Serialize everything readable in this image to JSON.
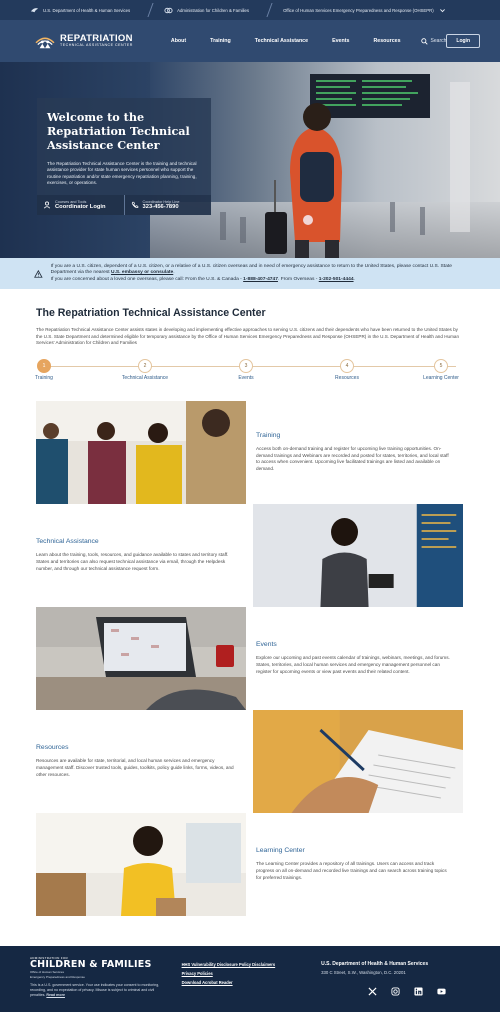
{
  "gov_bar": {
    "items": [
      {
        "label": "U.S. Department of Health & Human Services"
      },
      {
        "label": "Administration for Children & Families"
      },
      {
        "label": "Office of Human Services Emergency Preparedness and Response (OHSEPR)"
      }
    ]
  },
  "header": {
    "logo_title": "REPATRIATION",
    "logo_subtitle": "TECHNICAL ASSISTANCE CENTER",
    "nav": [
      {
        "label": "About"
      },
      {
        "label": "Training"
      },
      {
        "label": "Technical Assistance"
      },
      {
        "label": "Events"
      },
      {
        "label": "Resources"
      }
    ],
    "search_label": "Search",
    "login_label": "Login"
  },
  "hero": {
    "title": "Welcome to the Repatriation Technical Assistance Center",
    "description": "The Repatriation Technical Assistance Center is the training and technical assistance provider for state human services personnel who support the routine repatriation and/or state emergency repatriation planning, training, exercises, or operations.",
    "links": [
      {
        "label": "Courses and Tools",
        "value": "Coordinator Login"
      },
      {
        "label": "Coordinator Help Line",
        "value": "323-456-7890"
      }
    ]
  },
  "alert": {
    "line1": "If you are a U.S. citizen, dependent of a U.S. citizen, or a relative of a U.S. citizen overseas and in need of emergency assistance to return to the United States, please contact U.S. State Department via the nearest",
    "link1": "U.S. embassy or consulate",
    "line2": "If you are concerned about a loved one overseas, please call: From the U.S. & Canada -",
    "phone1": "1-888-407-4747",
    "line3": "From Overseas -",
    "phone2": "1-202-501-4444"
  },
  "intro": {
    "title": "The Repatriation Technical Assistance Center",
    "body": "The Repatriation Technical Assistance Center assists states in developing and implementing effective approaches to serving U.S. citizens and their dependents who have been returned to the United States by the U.S. State Department and determined eligible for temporary assistance by the Office of Human Services Emergency Preparedness and Response (OHSEPR) in the U.S. Department of Health and Human Services' Administration for Children and Families"
  },
  "steps": [
    {
      "num": "1",
      "label": "Training"
    },
    {
      "num": "2",
      "label": "Technical Assistance"
    },
    {
      "num": "3",
      "label": "Events"
    },
    {
      "num": "4",
      "label": "Resources"
    },
    {
      "num": "5",
      "label": "Learning Center"
    }
  ],
  "features": [
    {
      "title": "Training",
      "body": "Access both on-demand training and register for upcoming live training opportunities. On-demand trainings and Webinars are recorded and posted for states, territories, and local staff to access when convenient. Upcoming live facilitated trainings are listed and available on demand."
    },
    {
      "title": "Technical Assistance",
      "body": "Learn about the training, tools, resources, and guidance available to states and territory staff. States and territories can also request technical assistance via email, through the Helpdesk number, and through our technical assistance request form."
    },
    {
      "title": "Events",
      "body": "Explore our upcoming and past events calendar of trainings, webinars, meetings, and forums. States, territories, and local human services and emergency management personnel can register for upcoming events or view past events and their related content."
    },
    {
      "title": "Resources",
      "body": "Resources are available for state, territorial, and local human services and emergency management staff. Discover trusted tools, guides, toolkits, policy guide links, forms, videos, and other resources."
    },
    {
      "title": "Learning Center",
      "body": "The Learning Center provides a repository of all trainings. Users can access and track progress on all on-demand and recorded live trainings and can search across training topics for preferred trainings."
    }
  ],
  "footer": {
    "agency_top": "ADMINISTRATION FOR",
    "agency_name": "CHILDREN & FAMILIES",
    "office_line1": "Office of Human Services",
    "office_line2": "Emergency Preparedness and Response",
    "notice": "This is a U.S. government service. Your use indicates your consent to monitoring, recording, and no expectation of privacy. Misuse is subject to criminal and civil penalties.",
    "notice_link": "Read more",
    "links": [
      {
        "label": "HHS Vulnerability Disclosure Policy Disclaimers"
      },
      {
        "label": "Privacy Policies"
      },
      {
        "label": "Download Acrobat Reader"
      }
    ],
    "dept": "U.S. Department of Health & Human Services",
    "address": "330 C Street, S.W., Washington, D.C. 20201"
  },
  "colors": {
    "navy": "#233a5c",
    "header": "#304a70",
    "accent_orange": "#e6a55f",
    "link_blue": "#2f6496",
    "alert_bg": "#cfe3f3",
    "footer": "#152843"
  }
}
